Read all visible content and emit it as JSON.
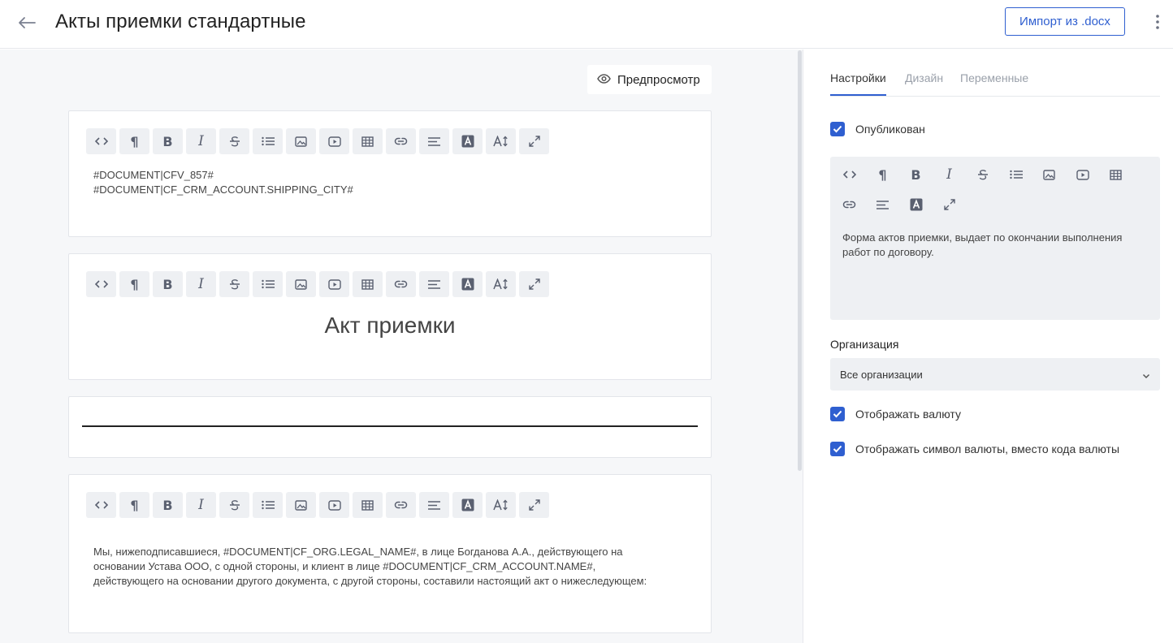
{
  "header": {
    "title": "Акты приемки стандартные",
    "import_label": "Импорт из .docx"
  },
  "main": {
    "preview_label": "Предпросмотр",
    "blocks": [
      {
        "lines": [
          "#DOCUMENT|CFV_857#",
          "#DOCUMENT|CF_CRM_ACCOUNT.SHIPPING_CITY#"
        ]
      },
      {
        "heading": "Акт приемки"
      },
      {
        "type": "divider"
      },
      {
        "lines": [
          "Мы, нижеподписавшиеся, #DOCUMENT|CF_ORG.LEGAL_NAME#, в лице Богданова А.А., действующего на",
          "основании Устава ООО, с одной стороны, и клиент в лице #DOCUMENT|CF_CRM_ACCOUNT.NAME#,",
          "действующего на основании другого документа, с другой стороны, составили настоящий акт о нижеследующем:"
        ]
      }
    ]
  },
  "panel": {
    "tabs": [
      {
        "label": "Настройки",
        "active": true
      },
      {
        "label": "Дизайн",
        "active": false
      },
      {
        "label": "Переменные",
        "active": false
      }
    ],
    "published_label": "Опубликован",
    "published_checked": true,
    "description_lines": [
      "Форма актов приемки, выдает по окончании выполнения",
      "работ по договору."
    ],
    "org_label": "Организация",
    "org_value": "Все организации",
    "show_currency_label": "Отображать валюту",
    "show_currency_checked": true,
    "show_symbol_label": "Отображать символ валюты, вместо кода валюты",
    "show_symbol_checked": true
  },
  "colors": {
    "accent": "#2f5fd0",
    "toolbar_bg": "#eef0f3",
    "page_bg": "#f6f7f9"
  },
  "toolbar_icons": [
    "code-icon",
    "paragraph-icon",
    "bold-icon",
    "italic-icon",
    "strikethrough-icon",
    "list-icon",
    "image-icon",
    "video-icon",
    "table-icon",
    "link-icon",
    "align-icon",
    "text-color-icon",
    "font-size-icon",
    "fullscreen-icon"
  ]
}
